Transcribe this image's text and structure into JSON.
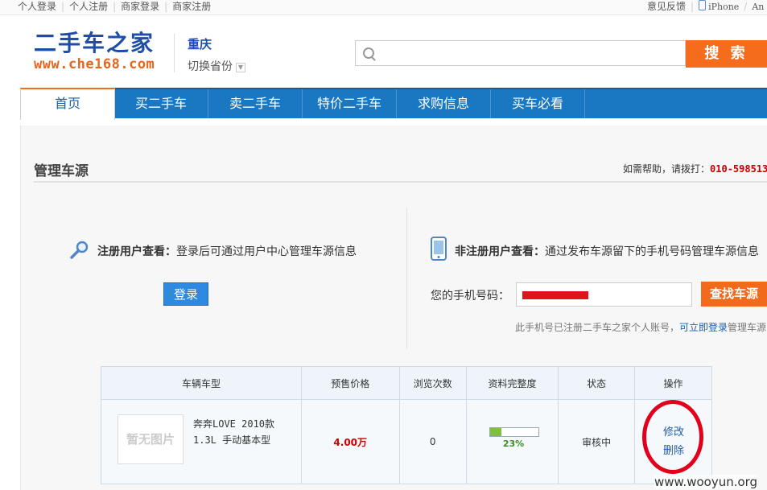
{
  "topbar": {
    "links": [
      "个人登录",
      "个人注册",
      "商家登录",
      "商家注册"
    ],
    "feedback": "意见反馈",
    "iphone": "iPhone",
    "more": "An"
  },
  "logo": {
    "cn": "二手车之家",
    "url": "www.che168.com"
  },
  "location": {
    "city": "重庆",
    "switch_label": "切换省份"
  },
  "search": {
    "value": "",
    "button": "搜 索"
  },
  "nav": [
    "首页",
    "买二手车",
    "卖二手车",
    "特价二手车",
    "求购信息",
    "买车必看"
  ],
  "page": {
    "title": "管理车源",
    "help_prefix": "如需帮助，请拨打：",
    "help_phone": "010-598513"
  },
  "registered": {
    "label": "注册用户查看：",
    "desc": "登录后可通过用户中心管理车源信息",
    "login_button": "登录"
  },
  "unregistered": {
    "label": "非注册用户查看：",
    "desc": "通过发布车源留下的手机号码管理车源信息",
    "phone_label": "您的手机号码：",
    "find_button": "查找车源",
    "note_prefix": "此手机号已注册二手车之家个人账号，",
    "note_link": "可立即登录",
    "note_suffix": "管理车源"
  },
  "table": {
    "headers": [
      "车辆车型",
      "预售价格",
      "浏览次数",
      "资料完整度",
      "状态",
      "操作"
    ],
    "rows": [
      {
        "thumb": "暂无图片",
        "name": "奔奔LOVE 2010款 1.3L 手动基本型",
        "price": "4.00万",
        "views": "0",
        "completeness": "23%",
        "completeness_fraction": 0.23,
        "status": "审核中",
        "edit": "修改",
        "delete": "删除"
      }
    ]
  },
  "watermark": "www.wooyun.org",
  "colors": {
    "brand_blue": "#1a78c2",
    "accent_orange": "#f56c1c",
    "annotation_red": "#e2001a"
  }
}
